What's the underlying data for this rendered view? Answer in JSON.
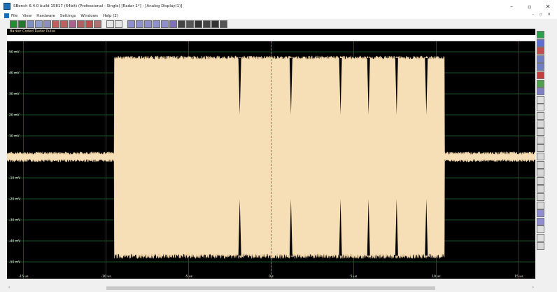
{
  "window": {
    "title": "SBench 6.4.0 build 15817 (64bit) (Professional - Single)   [Radar 1*] - [Analog Display(1)]",
    "minimize_glyph": "–",
    "maximize_glyph": "▫",
    "close_glyph": "✕"
  },
  "menu": {
    "items": [
      "File",
      "View",
      "Hardware",
      "Settings",
      "Windows",
      "Help (2)"
    ],
    "mdi_controls": "– ▫ ✕"
  },
  "toolbar": {
    "buttons": [
      {
        "icon": "run-icon",
        "color": "#1f8f2f"
      },
      {
        "icon": "run-loop-icon",
        "color": "#1f7a2f"
      },
      {
        "icon": "display-icon",
        "color": "#7f8fbf"
      },
      {
        "icon": "display-icon",
        "color": "#8f9fcf"
      },
      {
        "icon": "analog-display-icon",
        "color": "#8f8fbf"
      },
      {
        "icon": "chart-icon",
        "color": "#bf5f5f"
      },
      {
        "icon": "chart-icon",
        "color": "#bf6060"
      },
      {
        "icon": "chart-icon",
        "color": "#b05f8f"
      },
      {
        "icon": "chart-icon",
        "color": "#b06060"
      },
      {
        "icon": "chart-icon",
        "color": "#c05050"
      },
      {
        "icon": "chart-icon",
        "color": "#b07070"
      },
      {
        "icon": "sep"
      },
      {
        "icon": "blank-icon",
        "color": "#e6e6e6"
      },
      {
        "icon": "blank-icon",
        "color": "#e6e6e6"
      },
      {
        "icon": "sep"
      },
      {
        "icon": "wave-icon",
        "color": "#8f8fcf"
      },
      {
        "icon": "wave-icon",
        "color": "#8f8fcf"
      },
      {
        "icon": "wave-icon",
        "color": "#8f8fcf"
      },
      {
        "icon": "grid-icon",
        "color": "#8f8fcf"
      },
      {
        "icon": "grid-icon",
        "color": "#8f8fcf"
      },
      {
        "icon": "grid-icon",
        "color": "#7f6fbf"
      },
      {
        "icon": "zoom-icon",
        "color": "#444444"
      },
      {
        "icon": "zoom-icon",
        "color": "#555555"
      },
      {
        "icon": "close-icon",
        "color": "#333333"
      },
      {
        "icon": "table-icon",
        "color": "#444444"
      },
      {
        "icon": "table-icon",
        "color": "#333333"
      },
      {
        "icon": "table-icon",
        "color": "#555555"
      }
    ]
  },
  "right_tools": [
    {
      "icon": "channel-icon",
      "color": "#2f9f4f"
    },
    {
      "icon": "channel-icon",
      "color": "#5f6fcf"
    },
    {
      "icon": "chart-icon",
      "color": "#c04f4f"
    },
    {
      "icon": "analog-display-icon",
      "color": "#6f7fbf"
    },
    {
      "icon": "display-icon",
      "color": "#6f7fbf"
    },
    {
      "icon": "marker-icon",
      "color": "#c03f3f"
    },
    {
      "icon": "grid-icon",
      "color": "#4f9f4f"
    },
    {
      "icon": "calc-icon",
      "color": "#7f7fbf"
    },
    {
      "icon": "blank-icon",
      "color": "#e0e0e0"
    },
    {
      "icon": "blank-icon",
      "color": "#e0e0e0"
    },
    {
      "icon": "zoom-in-icon",
      "color": "#d8d8d8"
    },
    {
      "icon": "zoom-out-icon",
      "color": "#d8d8d8"
    },
    {
      "icon": "fit-icon",
      "color": "#d8d8d8"
    },
    {
      "icon": "fit-icon",
      "color": "#d8d8d8"
    },
    {
      "icon": "zoom-icon",
      "color": "#d8d8d8"
    },
    {
      "icon": "move-icon",
      "color": "#d8d8d8"
    },
    {
      "icon": "expand-icon",
      "color": "#d8d8d8"
    },
    {
      "icon": "expand-icon",
      "color": "#d8d8d8"
    },
    {
      "icon": "expand-icon",
      "color": "#d8d8d8"
    },
    {
      "icon": "expand-icon",
      "color": "#d8d8d8"
    },
    {
      "icon": "expand-icon",
      "color": "#d8d8d8"
    },
    {
      "icon": "expand-icon",
      "color": "#d8d8d8"
    },
    {
      "icon": "wave-icon",
      "color": "#8f8fcf"
    },
    {
      "icon": "table-icon",
      "color": "#8f8fcf"
    },
    {
      "icon": "undo-icon",
      "color": "#e0e0e0"
    },
    {
      "icon": "redo-icon",
      "color": "#e0e0e0"
    },
    {
      "icon": "close-icon",
      "color": "#d8d8d8"
    }
  ],
  "document": {
    "header_title": "Barker Coded Radar Pulse"
  },
  "plot": {
    "background": "#000000",
    "grid_color": "#1f6a2b",
    "signal_fill": "#f6dfb7",
    "signal_edge": "#e7c99a",
    "cursor_color": "#e05050",
    "y_labels": [
      "50 mV",
      "40 mV",
      "30 mV",
      "20 mV",
      "10 mV",
      "",
      "-10 mV",
      "-20 mV",
      "-30 mV",
      "-40 mV",
      "-50 mV"
    ],
    "x_labels": [
      "-15 us",
      "-10 us",
      "-5 us",
      "0 s",
      "5 us",
      "10 us",
      "15 us"
    ],
    "x_range_us": [
      -16,
      16
    ],
    "y_range_mv": [
      -58,
      55
    ],
    "pulse_start_us": -9.5,
    "pulse_end_us": 10.5,
    "pulse_amplitude_mv": 47,
    "noise_mv": 1.5,
    "cursor_us": 0,
    "phase_transitions_us": [
      -1.9,
      1.2,
      4.2,
      5.9,
      7.6,
      9.4
    ]
  }
}
